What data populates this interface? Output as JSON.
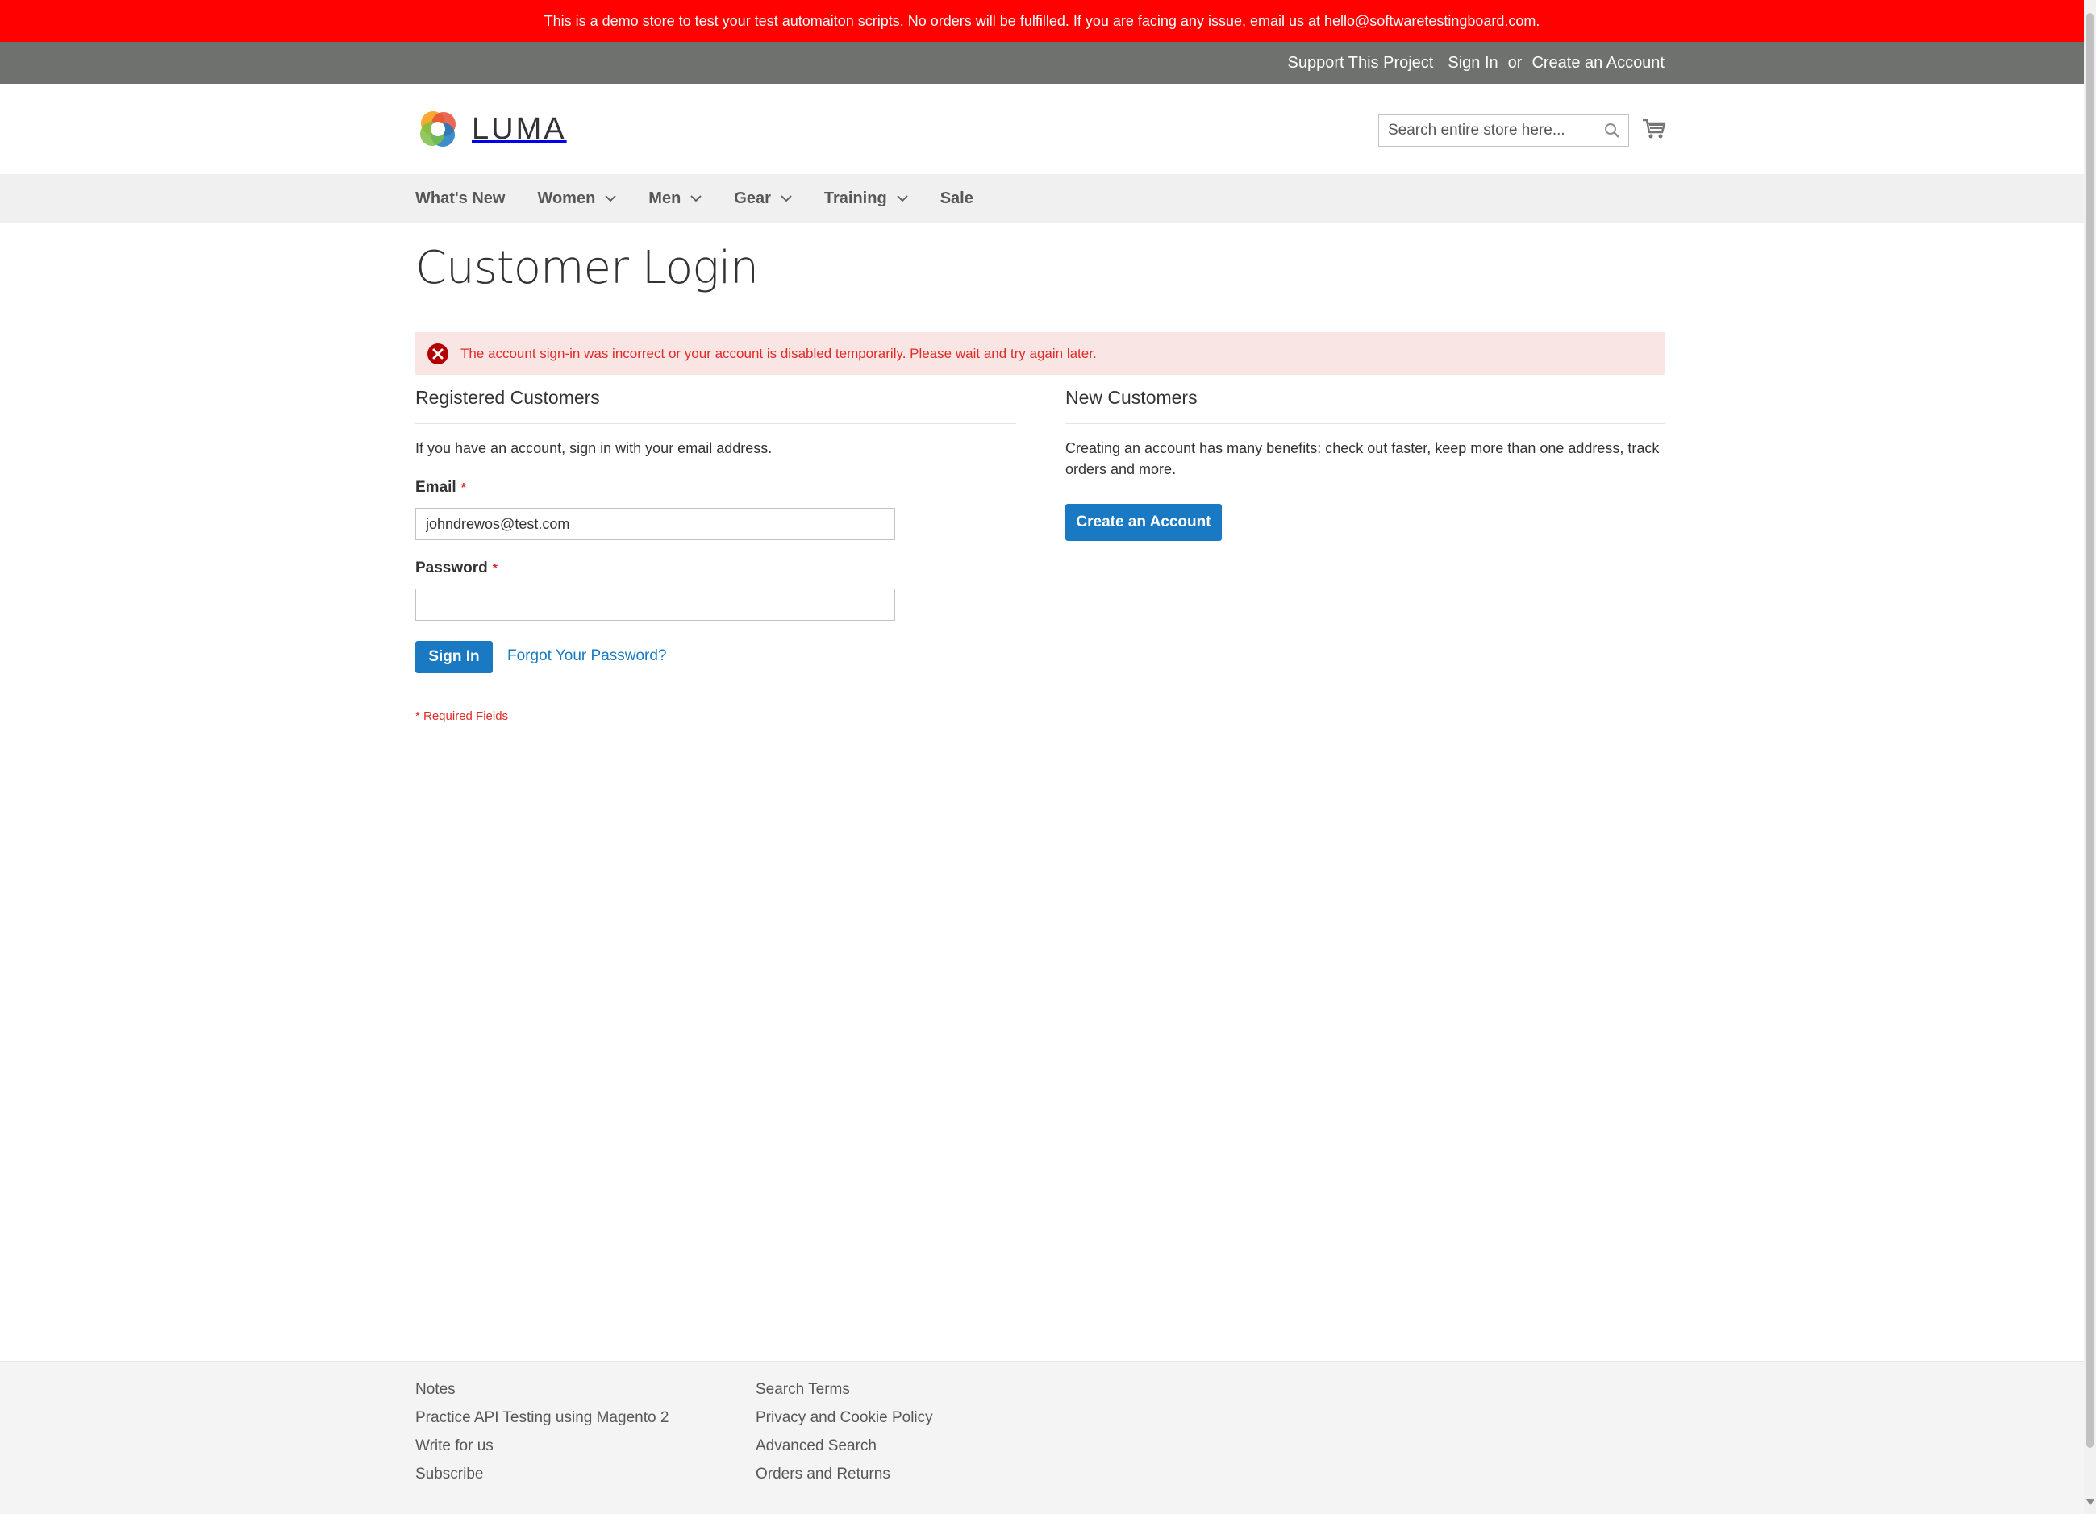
{
  "banner": {
    "text": "This is a demo store to test your test automaiton scripts. No orders will be fulfilled. If you are facing any issue, email us at hello@softwaretestingboard.com."
  },
  "top_links": {
    "support": "Support This Project",
    "sign_in": "Sign In",
    "or": "or",
    "create_account": "Create an Account"
  },
  "header": {
    "logo_text": "LUMA",
    "search_placeholder": "Search entire store here...",
    "search_icon": "search-icon",
    "cart_icon": "cart-icon"
  },
  "nav": {
    "items": [
      {
        "label": "What's New",
        "has_dropdown": false
      },
      {
        "label": "Women",
        "has_dropdown": true
      },
      {
        "label": "Men",
        "has_dropdown": true
      },
      {
        "label": "Gear",
        "has_dropdown": true
      },
      {
        "label": "Training",
        "has_dropdown": true
      },
      {
        "label": "Sale",
        "has_dropdown": false
      }
    ]
  },
  "page": {
    "title": "Customer Login",
    "error_message": "The account sign-in was incorrect or your account is disabled temporarily. Please wait and try again later."
  },
  "registered": {
    "title": "Registered Customers",
    "intro": "If you have an account, sign in with your email address.",
    "email_label": "Email",
    "email_value": "johndrewos@test.com",
    "password_label": "Password",
    "password_value": "",
    "required_mark": "*",
    "sign_in_button": "Sign In",
    "forgot_link": "Forgot Your Password?",
    "required_note": "* Required Fields"
  },
  "new_customers": {
    "title": "New Customers",
    "text": "Creating an account has many benefits: check out faster, keep more than one address, track orders and more.",
    "create_button": "Create an Account"
  },
  "footer": {
    "col1": [
      "Notes",
      "Practice API Testing using Magento 2",
      "Write for us",
      "Subscribe"
    ],
    "col2": [
      "Search Terms",
      "Privacy and Cookie Policy",
      "Advanced Search",
      "Orders and Returns"
    ]
  },
  "colors": {
    "banner_bg": "#ff0101",
    "top_bar_bg": "#6e716e",
    "primary": "#1979c3",
    "error_bg": "#fae5e5",
    "error_text": "#e02b27"
  }
}
